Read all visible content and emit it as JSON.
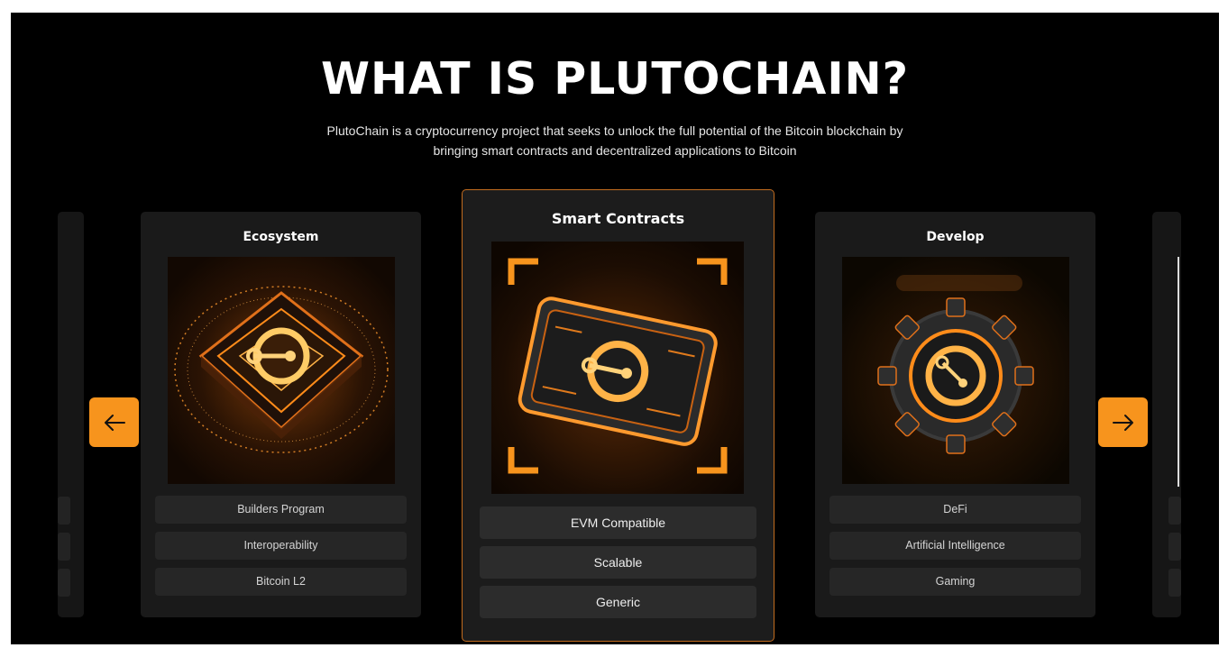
{
  "section": {
    "title": "WHAT IS PLUTOCHAIN?",
    "description_line1": "PlutoChain is a cryptocurrency project that seeks to unlock the full potential of the Bitcoin blockchain by",
    "description_line2": "bringing smart contracts and decentralized applications to Bitcoin"
  },
  "carousel": {
    "prev_icon": "arrow-left-icon",
    "next_icon": "arrow-right-icon",
    "accent_color": "#f7941d",
    "cards": [
      {
        "title": "Ecosystem",
        "image": "ecosystem-chip-illustration",
        "tags": [
          "Builders Program",
          "Interoperability",
          "Bitcoin L2"
        ]
      },
      {
        "title": "Smart Contracts",
        "image": "smart-contracts-card-illustration",
        "active": true,
        "tags": [
          "EVM Compatible",
          "Scalable",
          "Generic"
        ]
      },
      {
        "title": "Develop",
        "image": "develop-gear-illustration",
        "tags": [
          "DeFi",
          "Artificial Intelligence",
          "Gaming"
        ]
      }
    ]
  }
}
